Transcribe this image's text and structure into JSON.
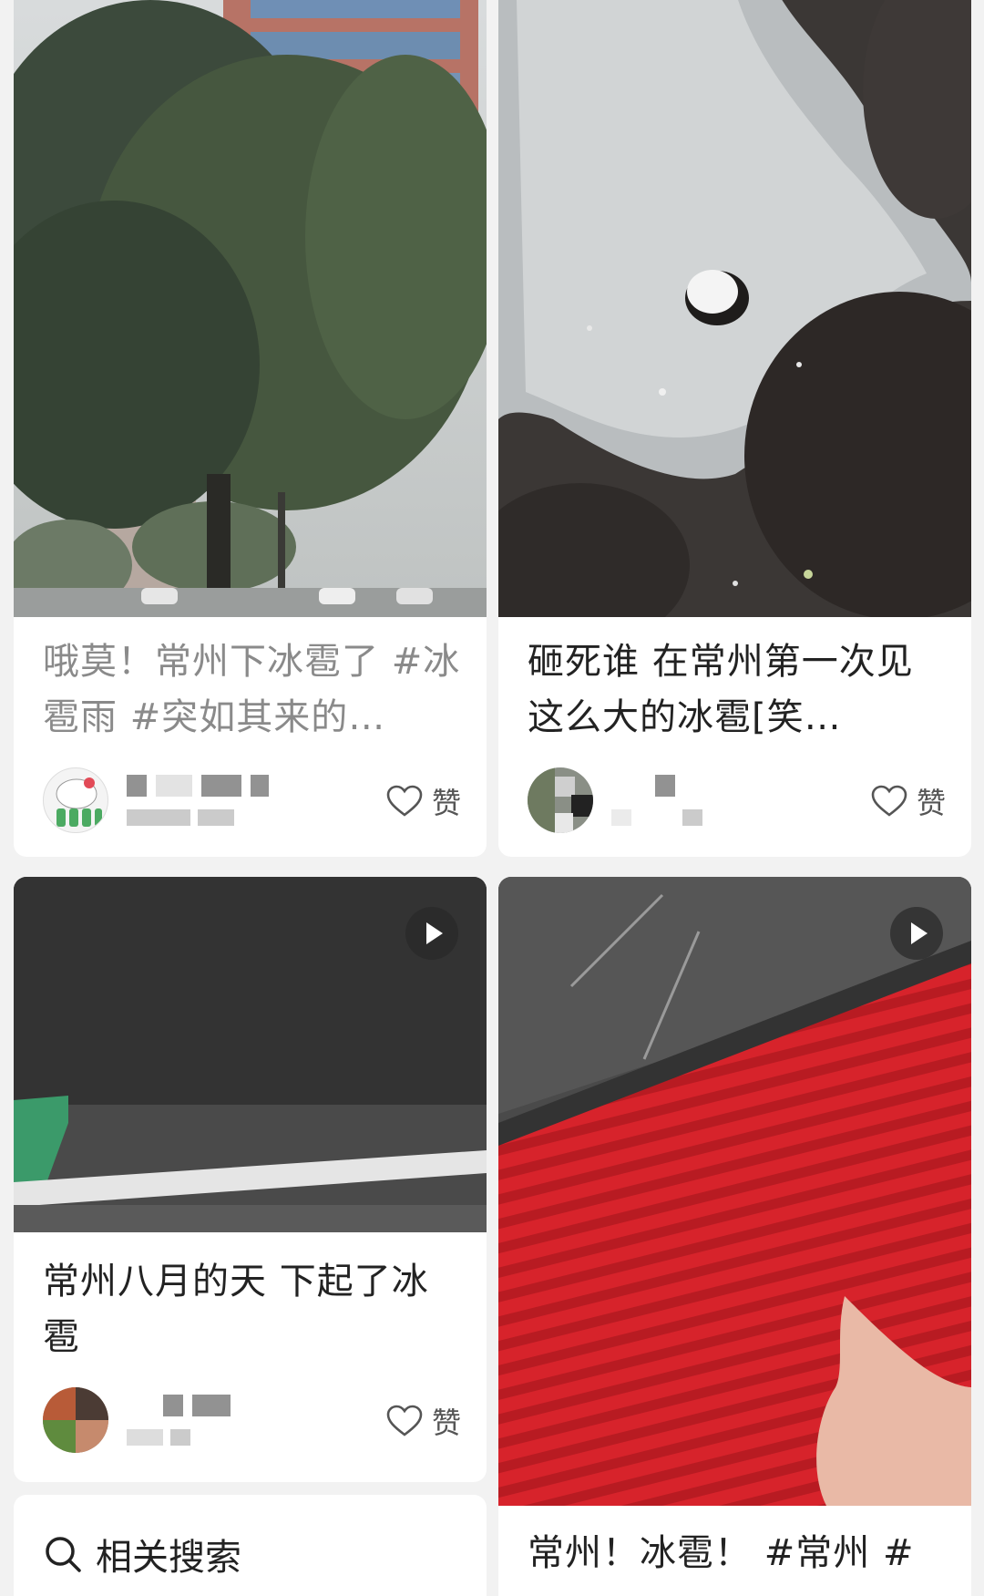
{
  "feed": {
    "posts": [
      {
        "title": "哦莫！常州下冰雹了 #冰雹雨 #突如其来的…",
        "like_label": "赞"
      },
      {
        "title": "砸死谁 在常州第一次见这么大的冰雹[笑…",
        "like_label": "赞"
      },
      {
        "title": "常州八月的天 下起了冰雹",
        "like_label": "赞"
      },
      {
        "title": "常州！冰雹！ #常州 #"
      }
    ]
  },
  "related_search": {
    "label": "相关搜索"
  },
  "icons": {
    "like": "heart-icon",
    "play": "play-icon",
    "search": "search-icon"
  },
  "colors": {
    "background": "#f2f2f2",
    "card": "#ffffff",
    "text_primary": "#222222",
    "text_secondary": "#8a8a8a"
  }
}
